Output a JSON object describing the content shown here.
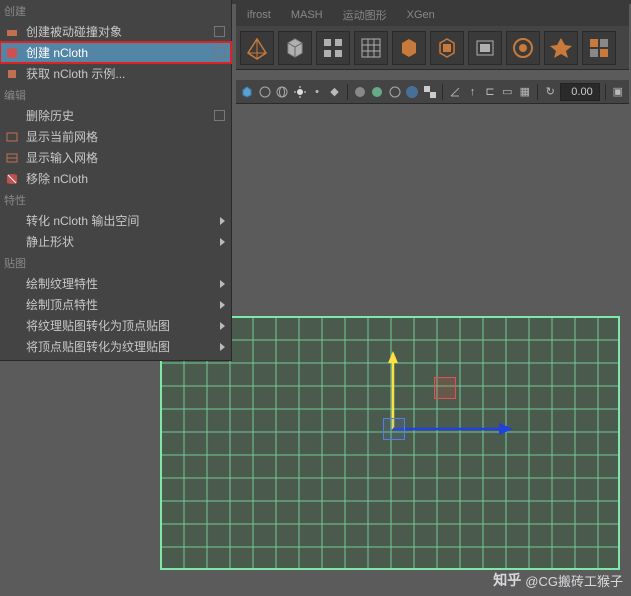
{
  "tabs": {
    "items": [
      "ifrost",
      "MASH",
      "运动图形",
      "XGen"
    ]
  },
  "menu": {
    "sections": [
      {
        "title": "创建",
        "items": [
          {
            "label": "创建被动碰撞对象",
            "icon": "passive-collider",
            "opt": true
          },
          {
            "label": "创建 nCloth",
            "icon": "create-ncloth",
            "opt": true,
            "highlight": true
          },
          {
            "label": "获取 nCloth 示例...",
            "icon": "ncloth-example"
          }
        ]
      },
      {
        "title": "编辑",
        "items": [
          {
            "label": "删除历史",
            "opt": true
          },
          {
            "label": "显示当前网格",
            "icon": "show-current"
          },
          {
            "label": "显示输入网格",
            "icon": "show-input"
          },
          {
            "label": "移除 nCloth",
            "icon": "remove-ncloth"
          }
        ]
      },
      {
        "title": "特性",
        "items": [
          {
            "label": "转化 nCloth 输出空间",
            "sub": true
          },
          {
            "label": "静止形状",
            "sub": true
          }
        ]
      },
      {
        "title": "贴图",
        "items": [
          {
            "label": "绘制纹理特性",
            "sub": true
          },
          {
            "label": "绘制顶点特性",
            "sub": true
          },
          {
            "label": "将纹理贴图转化为顶点贴图",
            "sub": true
          },
          {
            "label": "将顶点贴图转化为纹理贴图",
            "sub": true
          }
        ]
      }
    ]
  },
  "toolbar": {
    "value_field": "0.00"
  },
  "watermark": {
    "logo": "知乎",
    "text": "@CG搬砖工猴子"
  }
}
